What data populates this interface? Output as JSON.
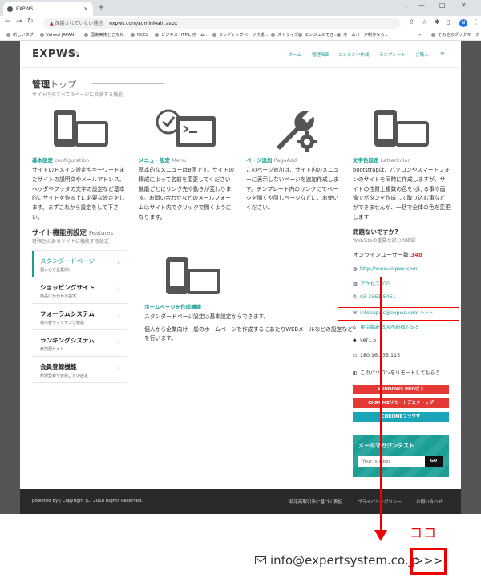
{
  "browser": {
    "tab_title": "EXPWS",
    "tab_close": "×",
    "new_tab": "+",
    "window_controls": [
      "⌄",
      "—",
      "□",
      "✕"
    ],
    "security_label": "保護されていない通信",
    "url": "expws.com/adminMain.aspx",
    "bookmarks": [
      "新しいタブ",
      "Yahoo! JAPAN",
      "国東美術とこなね",
      "NCCL",
      "ビジネス HTML ホーム...",
      "ランディングページ作成...",
      "ストライプ",
      "エンジェルでき...",
      "ホームページ制作なら...",
      "»",
      "その他のブックマーク"
    ],
    "profile_initial": "N"
  },
  "header": {
    "logo": "EXPWS.",
    "logo_sub": "CMS",
    "nav": [
      "ホーム",
      "管理画面",
      "コンテンツ作成",
      "テンプレート",
      "ご購入"
    ],
    "menu_icon": "≡"
  },
  "page": {
    "title_main": "管理",
    "title_light": "トップ",
    "subtitle": "サイト内のすべてのページに反映する機能"
  },
  "features": [
    {
      "icon": "mobile-desktop-icon",
      "title": "基本設定",
      "title_en": "configuration",
      "desc": "サイトのドメイン設定やキーワードまたサイトの説明文やメールアドレス、ヘッダやフッタの文字の設定など基本的にサイトを作る上に必要な設定をします。まずこれから設定をして下さい。"
    },
    {
      "icon": "clock-window-icon",
      "title": "メニュー設定",
      "title_en": "Menu",
      "desc": "基本的なメニューは8個です。サイトの構成によって名前を変更してください機能ごとにリンク先や動きが変わります。お問い合わせなどのメールフォームはサイト内でクリックで開くようになります。"
    },
    {
      "icon": "wrench-gear-icon",
      "title": "ページ追加",
      "title_en": "PageAdd",
      "desc": "このページ追加は、サイト内のメニューに表示しないページを追加作成します。テンプレート内のリンクにてページを開くや隠しページなどに、お使いください。"
    },
    {
      "icon": "mobile-desktop-icon",
      "title": "文字色設定",
      "title_en": "LetterColor",
      "desc": "bootstrapは、パソコンやスマートフォンのサイトを同時に作成しますが、サイトの性質上複数の色を付ける事や画像でボタンを作成して取り込む事などができませんが、一括で全体の色を変更します"
    }
  ],
  "section2": {
    "title": "サイト機能別設定",
    "title_en": "Features",
    "subtitle": "特殊性のあるサイトに機能する設定"
  },
  "side_menu": [
    {
      "title": "スタンダードページ",
      "sub": "個人から企業向け",
      "active": true
    },
    {
      "title": "ショッピングサイト",
      "sub": "商品にかかわる設定",
      "active": false
    },
    {
      "title": "フォーラムシステム",
      "sub": "掲示板やマッチング機能",
      "active": false
    },
    {
      "title": "ランキングシステム",
      "sub": "参加型サイト",
      "active": false
    },
    {
      "title": "会員登録機能",
      "sub": "新規登録や会員ごとの設定",
      "active": false
    }
  ],
  "side_menu_chevron": "›",
  "main_panel": {
    "title": "ホームページを作成機能",
    "desc1": "スタンダードページ設定は基本設定からできます。",
    "desc2": "個人から企業向け一般のホームページを作成するにあたりWEBメールなどの設定などを行います。"
  },
  "right_col": {
    "title": "問題ないですか?",
    "subtitle": "WebSiteの重要な部分の確認",
    "online_label": "オンラインユーザー数:",
    "online_count": "348",
    "links": [
      {
        "icon": "globe-icon",
        "glyph": "◍",
        "text": "http://www.expws.com"
      },
      {
        "icon": "chart-icon",
        "glyph": "▥",
        "text": "アクセスLOG"
      },
      {
        "icon": "phone-icon",
        "glyph": "✆",
        "text": "03-3361-5451"
      },
      {
        "icon": "mail-icon",
        "glyph": "✉",
        "text": "infoexpws@expws.com >>>"
      },
      {
        "icon": "home-icon",
        "glyph": "⌂",
        "text": "東京都新宿区西新宿7-5-5"
      },
      {
        "icon": "tag-icon",
        "glyph": "◆",
        "text": "ver1.5"
      },
      {
        "icon": "monitor-icon",
        "glyph": "▭",
        "text": "180.16.235.115"
      },
      {
        "icon": "remote-icon",
        "glyph": "◧",
        "text": "このパソコンをリモートしてもらう"
      }
    ],
    "buttons": [
      {
        "label": "WINDOWS PRO以上",
        "color": "#e53935"
      },
      {
        "label": "CHROMEリモートデスクトップ",
        "color": "#e53935"
      },
      {
        "label": "CHROMEブラウザ",
        "color": "#1aa6b8"
      }
    ],
    "newsletter_title": "メールマガジンテスト",
    "newsletter_placeholder": "Your number",
    "newsletter_button": "GO"
  },
  "footer": {
    "copyright": "powered by | Copyright (C) 2018 Rights Reserved.",
    "links": [
      "特定商取引法に基づく表記",
      "プライバシーポリシー",
      "お問い合わせ"
    ]
  },
  "annotation": {
    "label": "ココ",
    "email": "info@expertsystem.co.jp",
    "arrows": ">>>",
    "color": "#e00000"
  }
}
